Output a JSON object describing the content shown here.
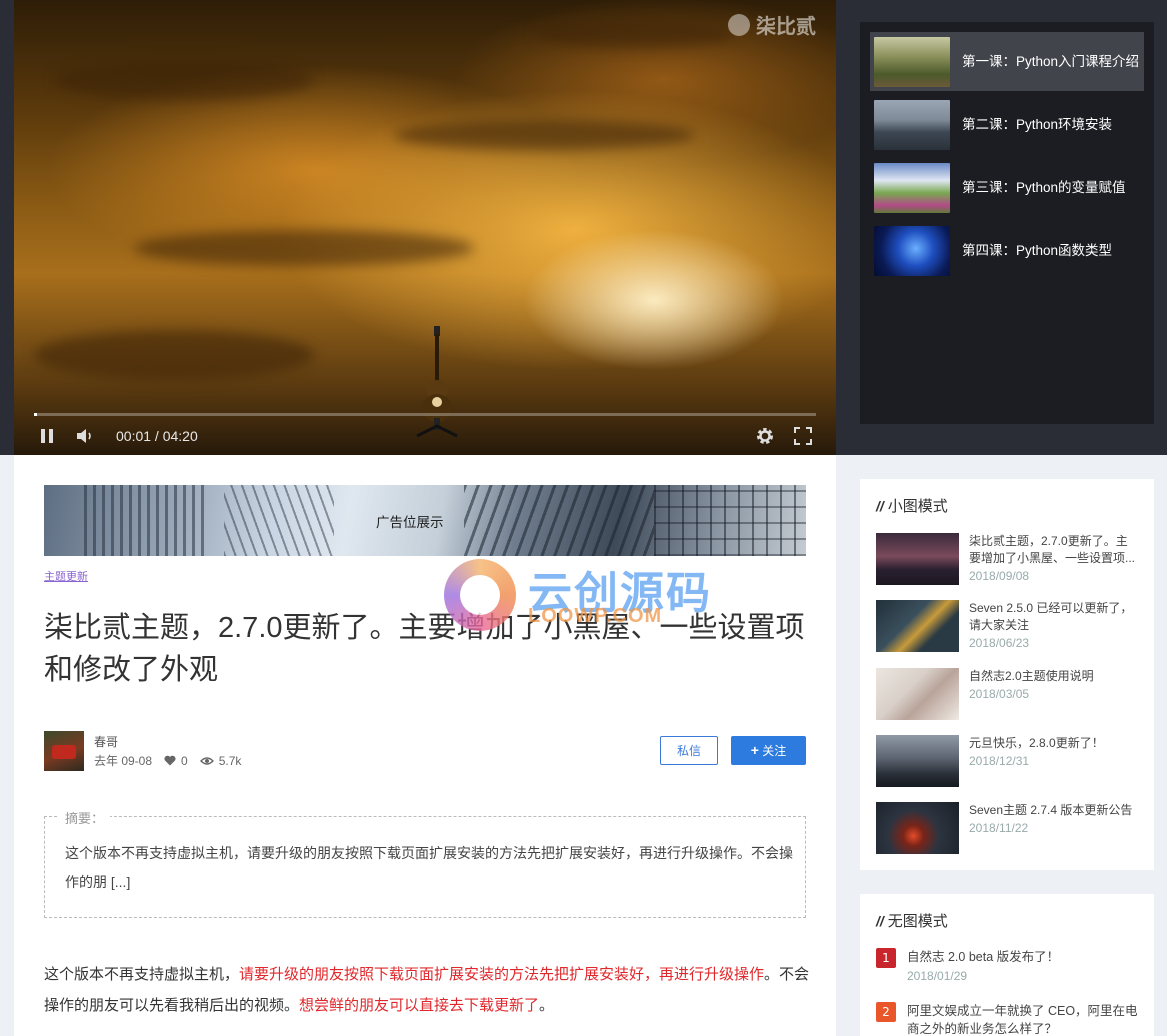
{
  "video": {
    "watermark_text": "柒比贰",
    "current_time": "00:01",
    "duration": "04:20",
    "time_display": "00:01 / 04:20",
    "progress_fraction": 0.004
  },
  "playlist": {
    "items": [
      {
        "title": "第一课：Python入门课程介绍",
        "active": true
      },
      {
        "title": "第二课：Python环境安装",
        "active": false
      },
      {
        "title": "第三课：Python的变量赋值",
        "active": false
      },
      {
        "title": "第四课：Python函数类型",
        "active": false
      }
    ]
  },
  "article": {
    "ad_text": "广告位展示",
    "category": "主题更新",
    "title": "柒比贰主题，2.7.0更新了。主要增加了小黑屋、一些设置项和修改了外观",
    "author": {
      "name": "春哥",
      "date": "去年 09-08",
      "likes": "0",
      "views": "5.7k"
    },
    "message_button": "私信",
    "follow_button": "关注",
    "summary_label": "摘要：",
    "summary_text": "这个版本不再支持虚拟主机，请要升级的朋友按照下载页面扩展安装的方法先把扩展安装好，再进行升级操作。不会操作的朋 [...]",
    "body": {
      "part1": "这个版本不再支持虚拟主机，",
      "part2_red": "请要升级的朋友按照下载页面扩展安装的方法先把扩展安装好，再进行升级操作",
      "part3": "。不会操作的朋友可以先看我稍后出的视频。",
      "part4_red": "想尝鲜的朋友可以直接去下载更新了",
      "part5": "。"
    }
  },
  "watermark": {
    "title": "云创源码",
    "sub": "LOOWP.COM"
  },
  "sidebar": {
    "small_image": {
      "heading": "小图模式",
      "items": [
        {
          "title": "柒比贰主题，2.7.0更新了。主要增加了小黑屋、一些设置项...",
          "date": "2018/09/08"
        },
        {
          "title": "Seven 2.5.0 已经可以更新了，请大家关注",
          "date": "2018/06/23"
        },
        {
          "title": "自然志2.0主题使用说明",
          "date": "2018/03/05"
        },
        {
          "title": "元旦快乐，2.8.0更新了！",
          "date": "2018/12/31"
        },
        {
          "title": "Seven主题 2.7.4 版本更新公告",
          "date": "2018/11/22"
        }
      ]
    },
    "no_image": {
      "heading": "无图模式",
      "items": [
        {
          "num": "1",
          "title": "自然志 2.0 beta 版发布了！",
          "date": "2018/01/29",
          "color": "#c8252c"
        },
        {
          "num": "2",
          "title": "阿里文娱成立一年就换了 CEO，阿里在电商之外的新业务怎么样了？",
          "date": "",
          "color": "#e8562a"
        }
      ]
    }
  },
  "colors": {
    "accent_blue": "#2e7be0",
    "highlight_red": "#e0282c",
    "dark_band": "#2a2d35"
  }
}
